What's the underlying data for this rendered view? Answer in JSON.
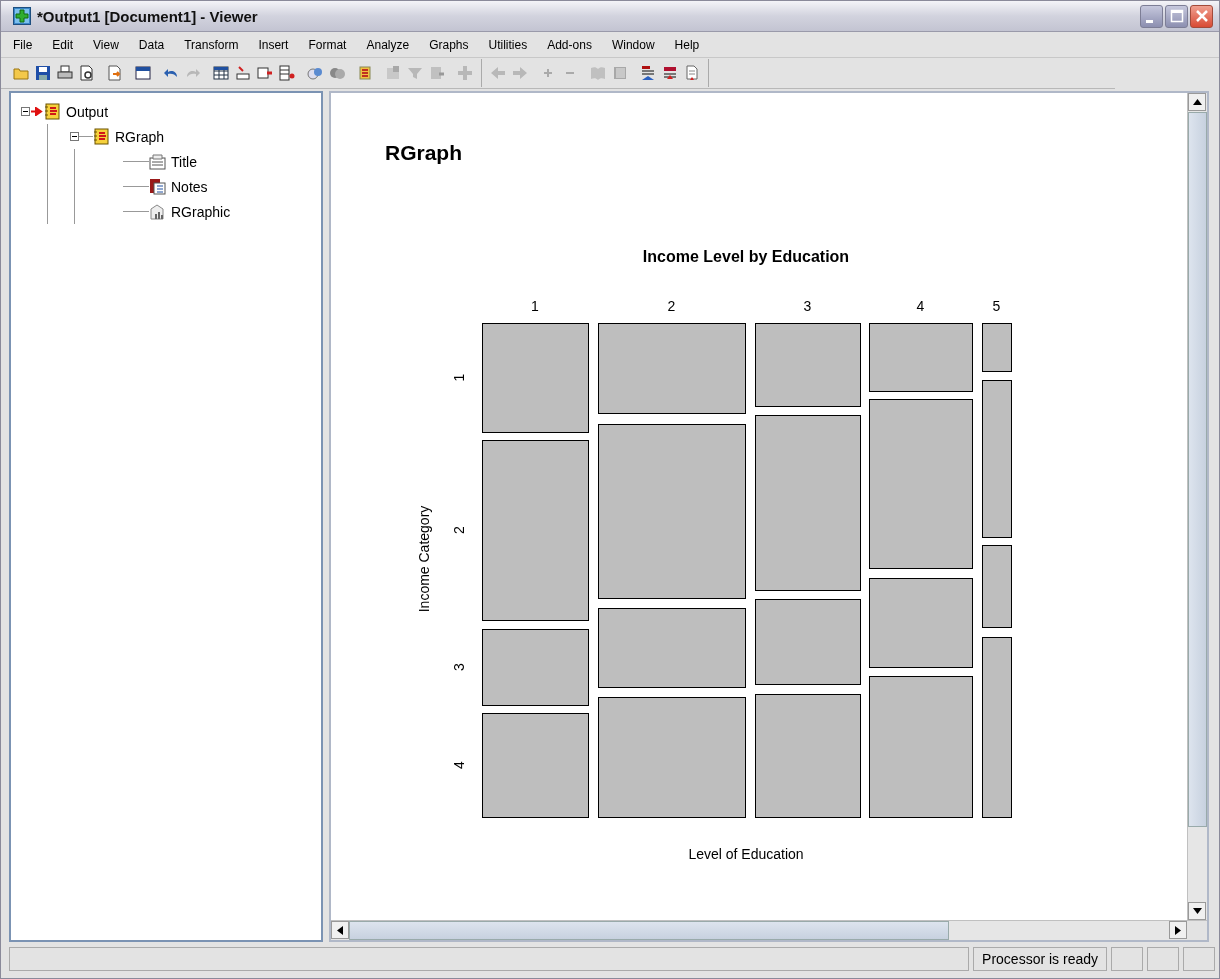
{
  "window": {
    "title": "*Output1 [Document1] - Viewer"
  },
  "menu": [
    "File",
    "Edit",
    "View",
    "Data",
    "Transform",
    "Insert",
    "Format",
    "Analyze",
    "Graphs",
    "Utilities",
    "Add-ons",
    "Window",
    "Help"
  ],
  "outline": [
    {
      "label": "Output",
      "kind": "heading",
      "expanded": true,
      "children": [
        {
          "label": "RGraph",
          "kind": "heading",
          "expanded": true,
          "children": [
            {
              "label": "Title",
              "kind": "title"
            },
            {
              "label": "Notes",
              "kind": "notes"
            },
            {
              "label": "RGraphic",
              "kind": "graph"
            }
          ]
        }
      ]
    }
  ],
  "content": {
    "heading": "RGraph",
    "plot": {
      "title": "Income Level by Education",
      "xlabel": "Level of Education",
      "ylabel": "Income Category",
      "columns": [
        "1",
        "2",
        "3",
        "4",
        "5"
      ],
      "rows": [
        "1",
        "2",
        "3",
        "4"
      ]
    }
  },
  "status_bar": {
    "message": "Processor is ready"
  }
}
